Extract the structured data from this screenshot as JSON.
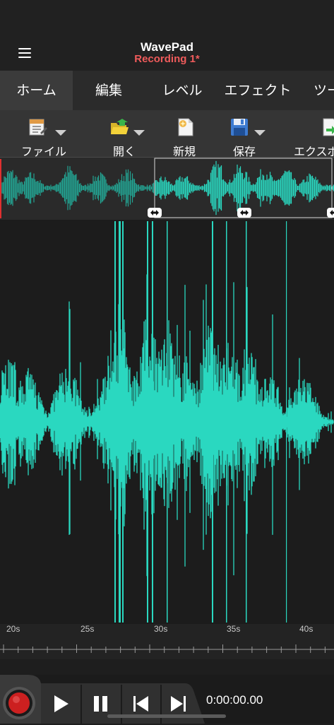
{
  "header": {
    "app_title": "WavePad",
    "document_title": "Recording 1*",
    "menu_icon": "hamburger-menu-icon"
  },
  "tabs": [
    {
      "label": "ホーム",
      "active": true
    },
    {
      "label": "編集",
      "active": false
    },
    {
      "label": "レベル",
      "active": false
    },
    {
      "label": "エフェクト",
      "active": false
    },
    {
      "label": "ツー",
      "active": false
    }
  ],
  "toolbar": [
    {
      "label": "ファイル",
      "icon": "file-icon",
      "dropdown": true
    },
    {
      "label": "開く",
      "icon": "open-folder-icon",
      "dropdown": true
    },
    {
      "label": "新規",
      "icon": "new-file-icon",
      "dropdown": false
    },
    {
      "label": "保存",
      "icon": "save-disk-icon",
      "dropdown": true
    },
    {
      "label": "エクスポ",
      "icon": "export-icon",
      "dropdown": false
    }
  ],
  "timeline": {
    "tick_labels": [
      "20s",
      "25s",
      "30s",
      "35s",
      "40s"
    ]
  },
  "transport": {
    "time": "0:00:00.00",
    "buttons": [
      "record-icon",
      "play-icon",
      "pause-icon",
      "skip-to-start-icon",
      "skip-to-end-icon"
    ]
  },
  "colors": {
    "waveform": "#2ad8c0",
    "waveform_unselected": "#23a493",
    "accent_title": "#ef5b5b",
    "record": "#cc2020"
  }
}
